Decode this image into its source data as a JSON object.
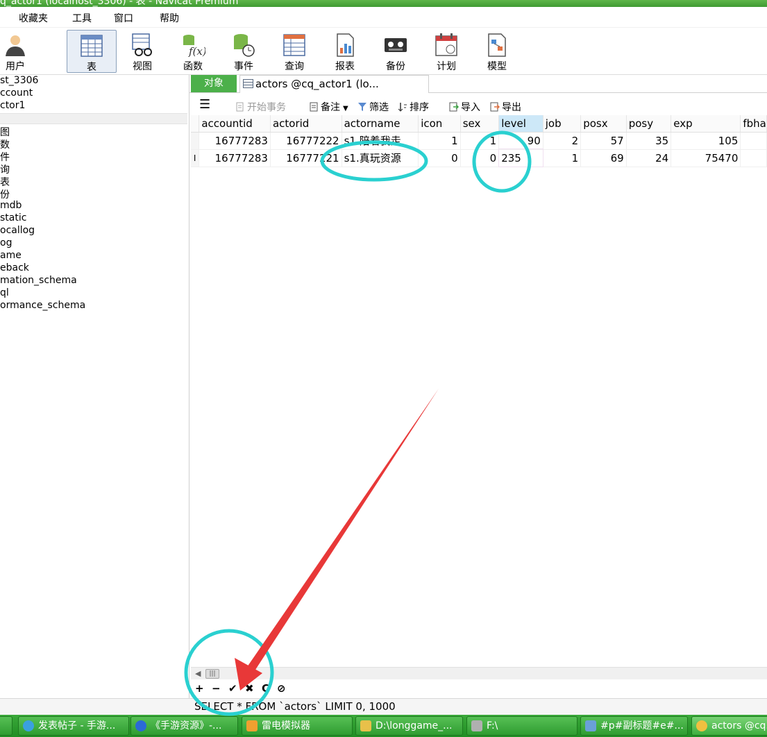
{
  "window": {
    "title": "q_actor1 (localhost_3306) - 表 - Navicat Premium"
  },
  "menu": [
    "收藏夹",
    "工具",
    "窗口",
    "帮助"
  ],
  "toolbar": [
    {
      "label": "用户",
      "icon": "user-icon"
    },
    {
      "label": "表",
      "icon": "table-icon",
      "active": true
    },
    {
      "label": "视图",
      "icon": "view-icon"
    },
    {
      "label": "函数",
      "icon": "function-icon"
    },
    {
      "label": "事件",
      "icon": "event-icon"
    },
    {
      "label": "查询",
      "icon": "query-icon"
    },
    {
      "label": "报表",
      "icon": "report-icon"
    },
    {
      "label": "备份",
      "icon": "backup-icon"
    },
    {
      "label": "计划",
      "icon": "schedule-icon"
    },
    {
      "label": "模型",
      "icon": "model-icon"
    }
  ],
  "tree": {
    "top": [
      "st_3306",
      "ccount",
      "ctor1"
    ],
    "items": [
      "图",
      "数",
      "件",
      "询",
      "表",
      "份",
      "mdb",
      "static",
      "ocallog",
      "og",
      "ame",
      "eback",
      "mation_schema",
      "ql",
      "ormance_schema"
    ]
  },
  "tabs": {
    "objects": "对象",
    "actors": "actors @cq_actor1 (lo..."
  },
  "gridbar": {
    "begin_tx": "开始事务",
    "note": "备注",
    "filter": "筛选",
    "sort": "排序",
    "import": "导入",
    "export": "导出"
  },
  "grid": {
    "columns": [
      "accountid",
      "actorid",
      "actorname",
      "icon",
      "sex",
      "level",
      "job",
      "posx",
      "posy",
      "exp",
      "fbha"
    ],
    "rows": [
      [
        "16777283",
        "16777222",
        "s1.陪着我走",
        "1",
        "1",
        "90",
        "2",
        "57",
        "35",
        "105",
        ""
      ],
      [
        "16777283",
        "16777221",
        "s1.真玩资源",
        "0",
        "0",
        "235",
        "1",
        "69",
        "24",
        "75470",
        ""
      ]
    ],
    "row_marker": "I"
  },
  "recnav": {
    "add": "+",
    "remove": "−",
    "apply": "✔",
    "cancel": "✖",
    "refresh": "C",
    "stop": "⊘"
  },
  "status": {
    "sql": "SELECT * FROM `actors` LIMIT 0, 1000"
  },
  "taskbar": [
    {
      "label": "发表帖子 - 手游...",
      "color": "#3aa0e0"
    },
    {
      "label": "《手游资源》-...",
      "color": "#2b6ad6"
    },
    {
      "label": "雷电模拟器",
      "color": "#f0a030"
    },
    {
      "label": "D:\\longgame_...",
      "color": "#e8c04a"
    },
    {
      "label": "F:\\",
      "color": "#b0b0b0"
    },
    {
      "label": "#p#副标题#e#...",
      "color": "#6aa0d8"
    },
    {
      "label": "actors @cq...",
      "color": "#f0c040"
    }
  ],
  "annotation": {
    "circle_color": "#2ad0d0",
    "arrow_color": "#e83838"
  }
}
